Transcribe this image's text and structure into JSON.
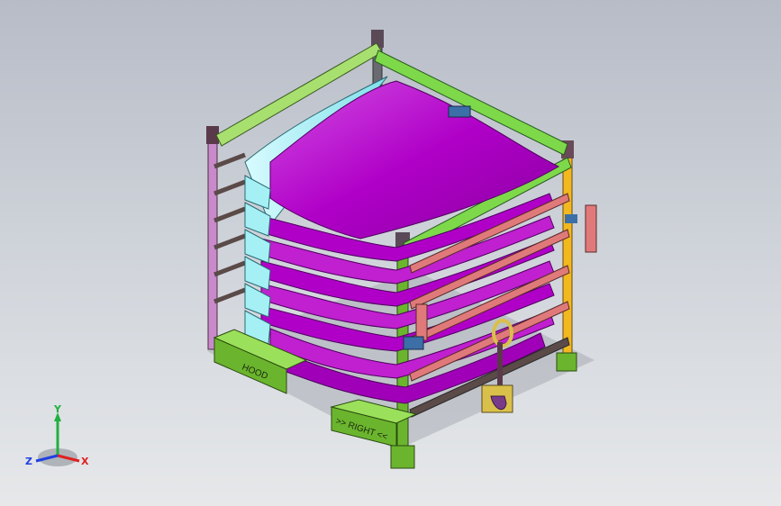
{
  "model": {
    "labels": {
      "hood": "HOOD",
      "right": ">> RIGHT <<"
    },
    "colors": {
      "background_top": "#b7bcc7",
      "background_bottom": "#e6e8ea",
      "panel": "#b000c8",
      "panel_light": "#d24ee2",
      "panel_top": "#a5f0f5",
      "frame_green": "#7dd94a",
      "post_dark": "#5a4a48",
      "rail_pink": "#e07a7a",
      "rail_yellow": "#f2b81f",
      "foot_green": "#6bb52e",
      "bracket_blue": "#3c6fa8"
    }
  },
  "triad": {
    "x_label": "X",
    "y_label": "Y",
    "z_label": "Z",
    "x_color": "#e02020",
    "y_color": "#20b040",
    "z_color": "#2040e0"
  }
}
